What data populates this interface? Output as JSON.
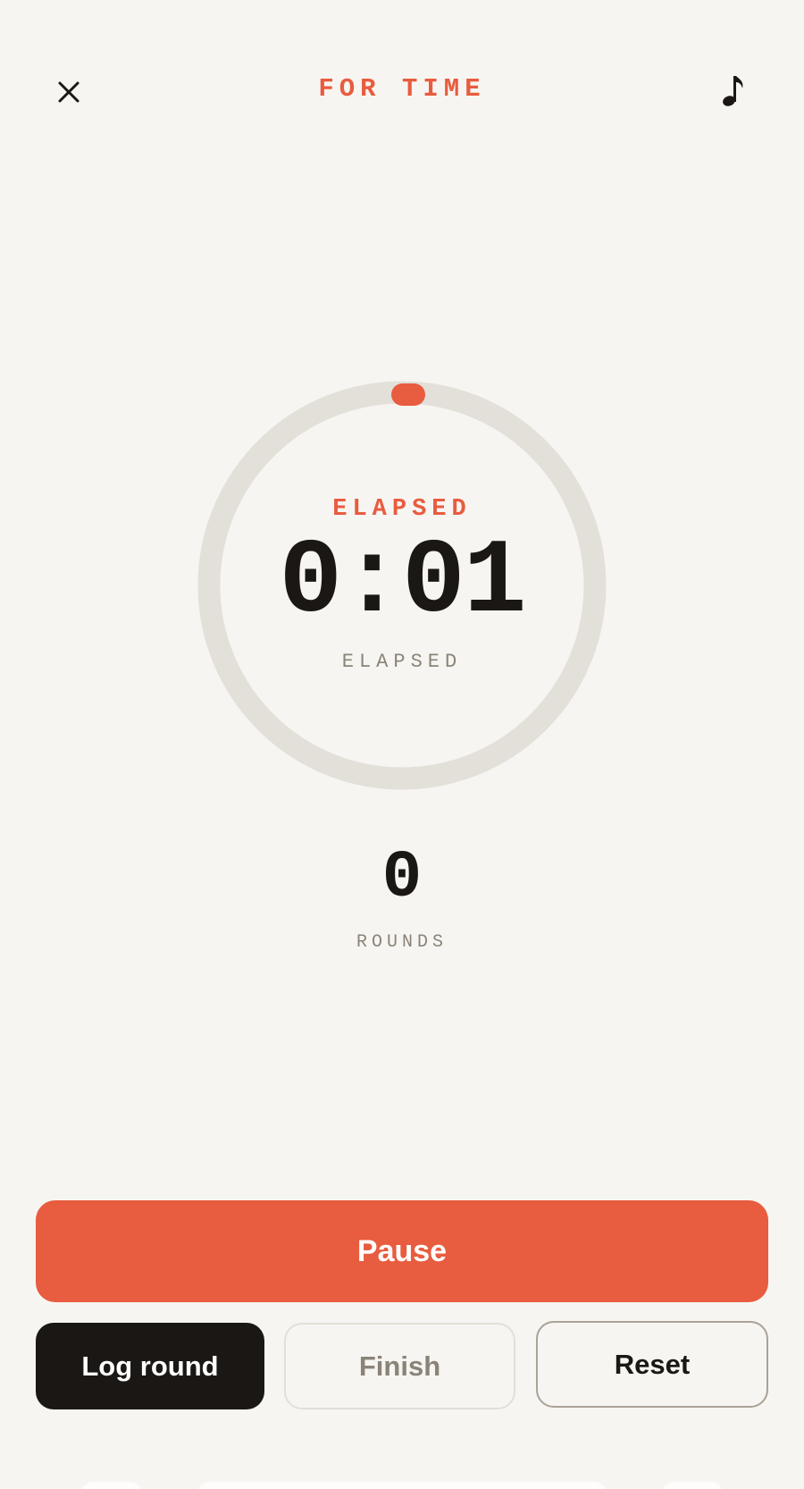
{
  "header": {
    "title": "FOR TIME",
    "close_icon": "close-icon",
    "music_icon": "music-note-icon",
    "music_glyph": "♪"
  },
  "timer": {
    "label_top": "ELAPSED",
    "value": "0:01",
    "label_bottom": "ELAPSED",
    "progress": 0.0
  },
  "rounds": {
    "value": "0",
    "label": "ROUNDS"
  },
  "actions": {
    "pause_label": "Pause",
    "log_round_label": "Log round",
    "finish_label": "Finish",
    "reset_label": "Reset"
  },
  "colors": {
    "accent": "#e85c3f",
    "background": "#f7f5f1",
    "dark": "#1a1714",
    "muted": "#8a8378",
    "ring_track": "#e3e0da"
  }
}
